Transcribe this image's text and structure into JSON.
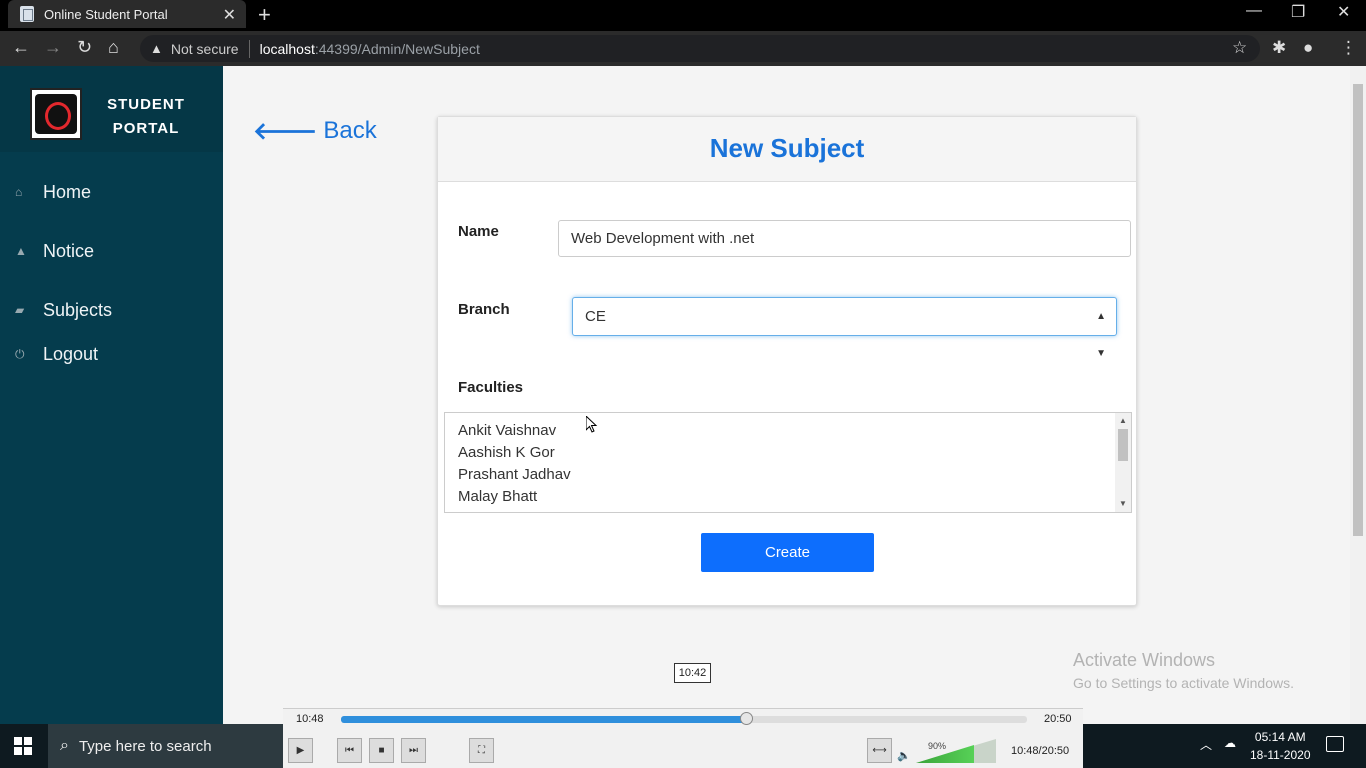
{
  "browser": {
    "tab_title": "Online Student Portal",
    "tab_close": "✕",
    "new_tab": "+",
    "security_label": "Not secure",
    "url_host": "localhost",
    "url_path": ":44399/Admin/NewSubject"
  },
  "sidebar": {
    "brand_line1": "STUDENT",
    "brand_line2": "PORTAL",
    "items": [
      {
        "label": "Home",
        "icon": "home-icon"
      },
      {
        "label": "Notice",
        "icon": "bell-icon"
      },
      {
        "label": "Subjects",
        "icon": "book-icon"
      },
      {
        "label": "Logout",
        "icon": "power-icon"
      }
    ]
  },
  "back_label": "Back",
  "form": {
    "title": "New Subject",
    "name_label": "Name",
    "name_value": "Web Development with .net",
    "branch_label": "Branch",
    "branch_value": "CE",
    "faculties_label": "Faculties",
    "faculties": [
      "Ankit Vaishnav",
      "Aashish K Gor",
      "Prashant Jadhav",
      "Malay Bhatt"
    ],
    "create_label": "Create"
  },
  "watermark": {
    "line1": "Activate Windows",
    "line2": "Go to Settings to activate Windows."
  },
  "media_player": {
    "tooltip": "10:42",
    "elapsed": "10:48",
    "total": "20:50",
    "progress": 0.59,
    "volume_label": "90%",
    "clock": "10:48/20:50"
  },
  "taskbar": {
    "search_placeholder": "Type here to search",
    "time": "05:14 AM",
    "date": "18-11-2020"
  }
}
